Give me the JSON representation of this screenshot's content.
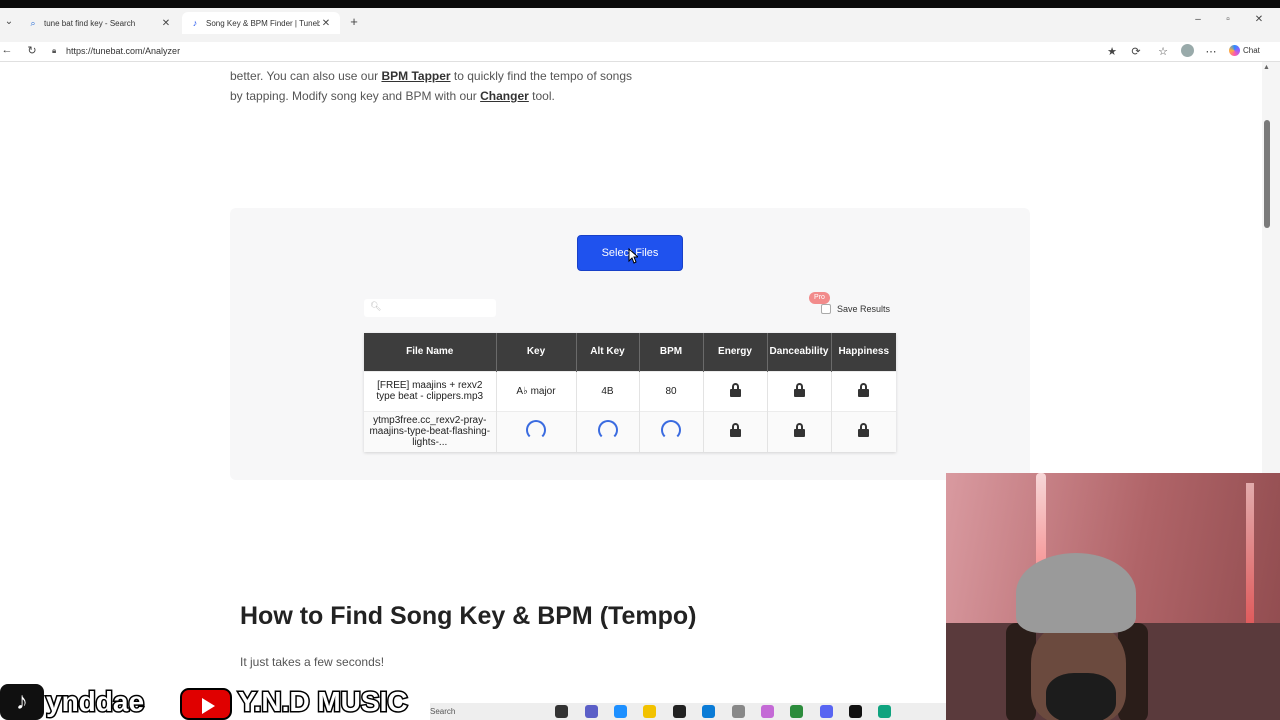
{
  "browser": {
    "tabs": [
      {
        "title": "tune bat find key - Search",
        "active": false
      },
      {
        "title": "Song Key & BPM Finder | Tunebat",
        "active": true
      }
    ],
    "url": "https://tunebat.com/Analyzer",
    "chat_label": "Chat"
  },
  "intro": {
    "line1_prefix": "better. You can also use our ",
    "bpm_tapper_link": "BPM Tapper",
    "line1_suffix": " to quickly find the tempo of songs",
    "line2_prefix": "by tapping. Modify song key and BPM with our ",
    "changer_link": "Changer",
    "line2_suffix": " tool."
  },
  "analyzer": {
    "select_files_label": "Select Files",
    "search_placeholder": "",
    "pro_badge": "Pro",
    "save_results_label": "Save Results",
    "save_results_checked": false,
    "columns": [
      "File Name",
      "Key",
      "Alt Key",
      "BPM",
      "Energy",
      "Danceability",
      "Happiness"
    ],
    "rows": [
      {
        "file_name": "[FREE] maajins + rexv2 type beat - clippers.mp3",
        "key": "A♭ major",
        "alt_key": "4B",
        "bpm": "80",
        "loading": false
      },
      {
        "file_name": "ytmp3free.cc_rexv2-pray-maajins-type-beat-flashing-lights-...",
        "key": "",
        "alt_key": "",
        "bpm": "",
        "loading": true
      }
    ]
  },
  "howto": {
    "heading": "How to Find Song Key & BPM (Tempo)",
    "subtext": "It just takes a few seconds!"
  },
  "taskbar": {
    "search_label": "Search"
  },
  "overlay": {
    "tiktok_handle": "ynddae",
    "youtube_channel": "Y.N.D MUSIC"
  },
  "colors": {
    "accent": "#1f52ee",
    "table_header": "#3d3d3d",
    "pro_badge": "#f28b8b"
  }
}
